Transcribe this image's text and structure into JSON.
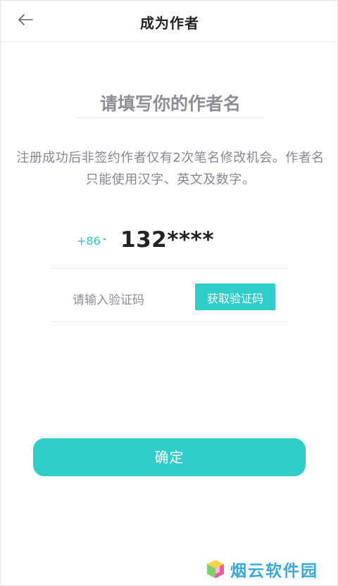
{
  "header": {
    "title": "成为作者",
    "back_icon": "arrow-left-icon"
  },
  "author_name": {
    "placeholder": "请填写你的作者名",
    "value": ""
  },
  "notice": {
    "text": "注册成功后非签约作者仅有2次笔名修改机会。作者名只能使用汉字、英文及数字。"
  },
  "phone": {
    "country_code": "+86",
    "number": "132****"
  },
  "verification": {
    "placeholder": "请输入验证码",
    "value": "",
    "button_label": "获取验证码"
  },
  "confirm": {
    "label": "确定"
  },
  "watermark": {
    "text": "烟云软件园"
  },
  "colors": {
    "accent": "#2ecdc9",
    "accent_text": "#2ec6c6",
    "muted_text": "#878794",
    "title_text": "#222222"
  }
}
